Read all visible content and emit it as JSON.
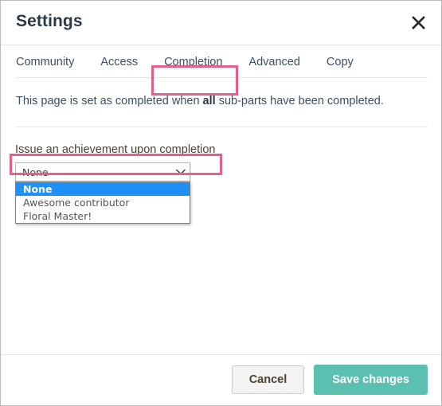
{
  "colors": {
    "annotation_pink": "#e25f8e",
    "save_teal": "#5cc0b0",
    "option_highlight_blue": "#1f90f5",
    "dialog_border": "#b9b9b9"
  },
  "dialog": {
    "title": "Settings",
    "close_icon": "close-icon"
  },
  "tabs": {
    "items": [
      {
        "label": "Community",
        "name": "tab-community",
        "active": false
      },
      {
        "label": "Access",
        "name": "tab-access",
        "active": false
      },
      {
        "label": "Completion",
        "name": "tab-completion",
        "active": true
      },
      {
        "label": "Advanced",
        "name": "tab-advanced",
        "active": false
      },
      {
        "label": "Copy",
        "name": "tab-copy",
        "active": false
      }
    ]
  },
  "body": {
    "info_text_before": "This page is set as completed when ",
    "info_text_bold": "all",
    "info_text_after": " sub-parts have been completed.",
    "field_label": "Issue an achievement upon completion",
    "select": {
      "value": "None",
      "caret_icon": "chevron-down-icon",
      "options": [
        {
          "label": "None",
          "selected": true
        },
        {
          "label": "Awesome contributor",
          "selected": false
        },
        {
          "label": "Floral Master!",
          "selected": false
        }
      ]
    }
  },
  "footer": {
    "cancel_label": "Cancel",
    "save_label": "Save changes"
  }
}
